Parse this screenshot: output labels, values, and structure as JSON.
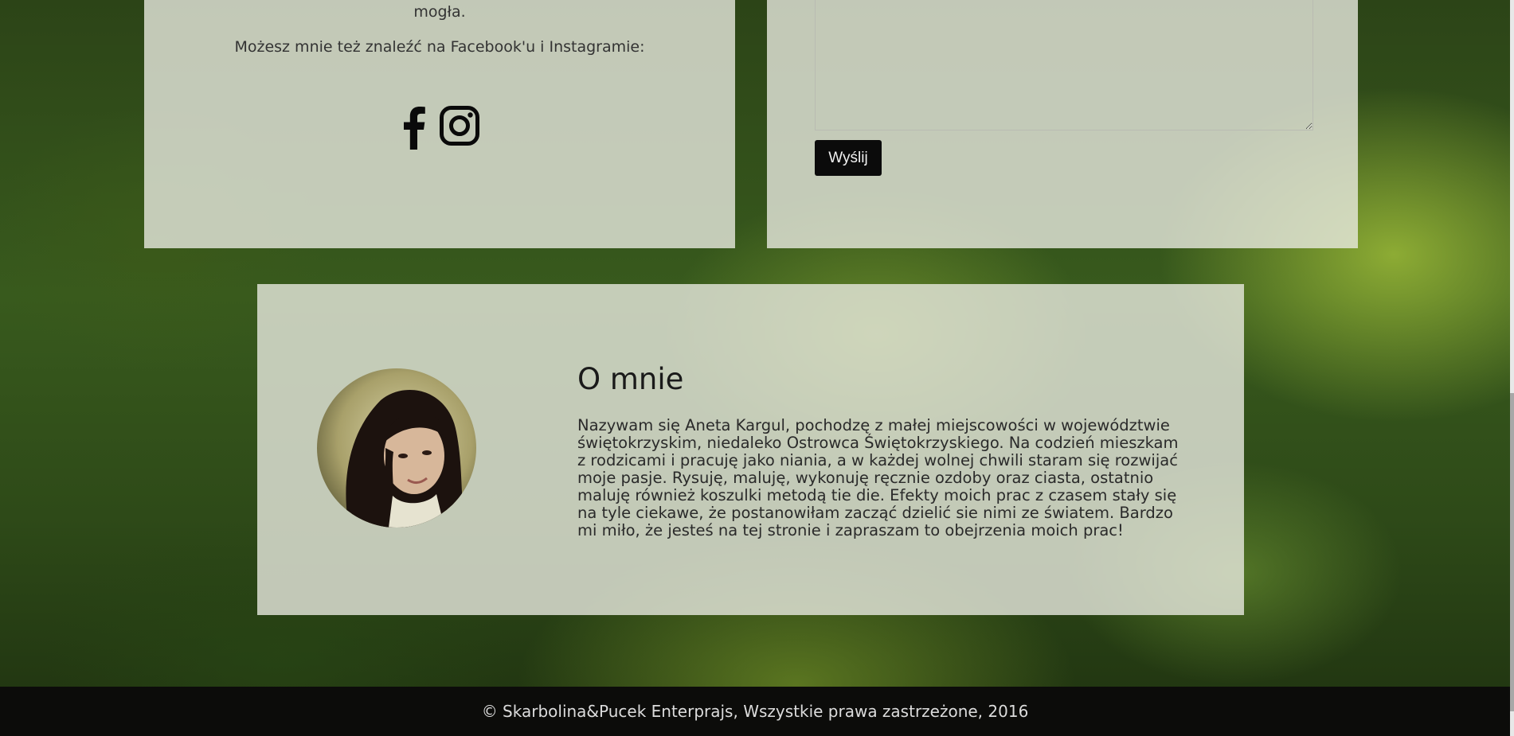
{
  "contact_info": {
    "partial_line": "mogła.",
    "social_text": "Możesz mnie też znaleźć na Facebook'u i Instagramie:",
    "social_links": [
      {
        "name": "Facebook",
        "icon": "facebook-icon"
      },
      {
        "name": "Instagram",
        "icon": "instagram-icon"
      }
    ]
  },
  "contact_form": {
    "message_value": "",
    "send_label": "Wyślij"
  },
  "about": {
    "title": "O mnie",
    "text": "Nazywam się Aneta Kargul, pochodzę z małej miejscowości w województwie świętokrzyskim, niedaleko Ostrowca Świętokrzyskiego. Na codzień mieszkam z rodzicami i pracuję jako niania, a w każdej wolnej chwili staram się rozwijać moje pasje. Rysuję, maluję, wykonuję ręcznie ozdoby oraz ciasta, ostatnio maluję również koszulki metodą tie die. Efekty moich prac z czasem stały się na tyle ciekawe, że postanowiłam zacząć dzielić sie nimi ze światem. Bardzo mi miło, że jesteś na tej stronie i zapraszam to obejrzenia moich prac!",
    "avatar": "profile-photo"
  },
  "footer": {
    "copyright": "© Skarbolina&Pucek Enterprajs, Wszystkie prawa zastrzeżone, 2016"
  }
}
